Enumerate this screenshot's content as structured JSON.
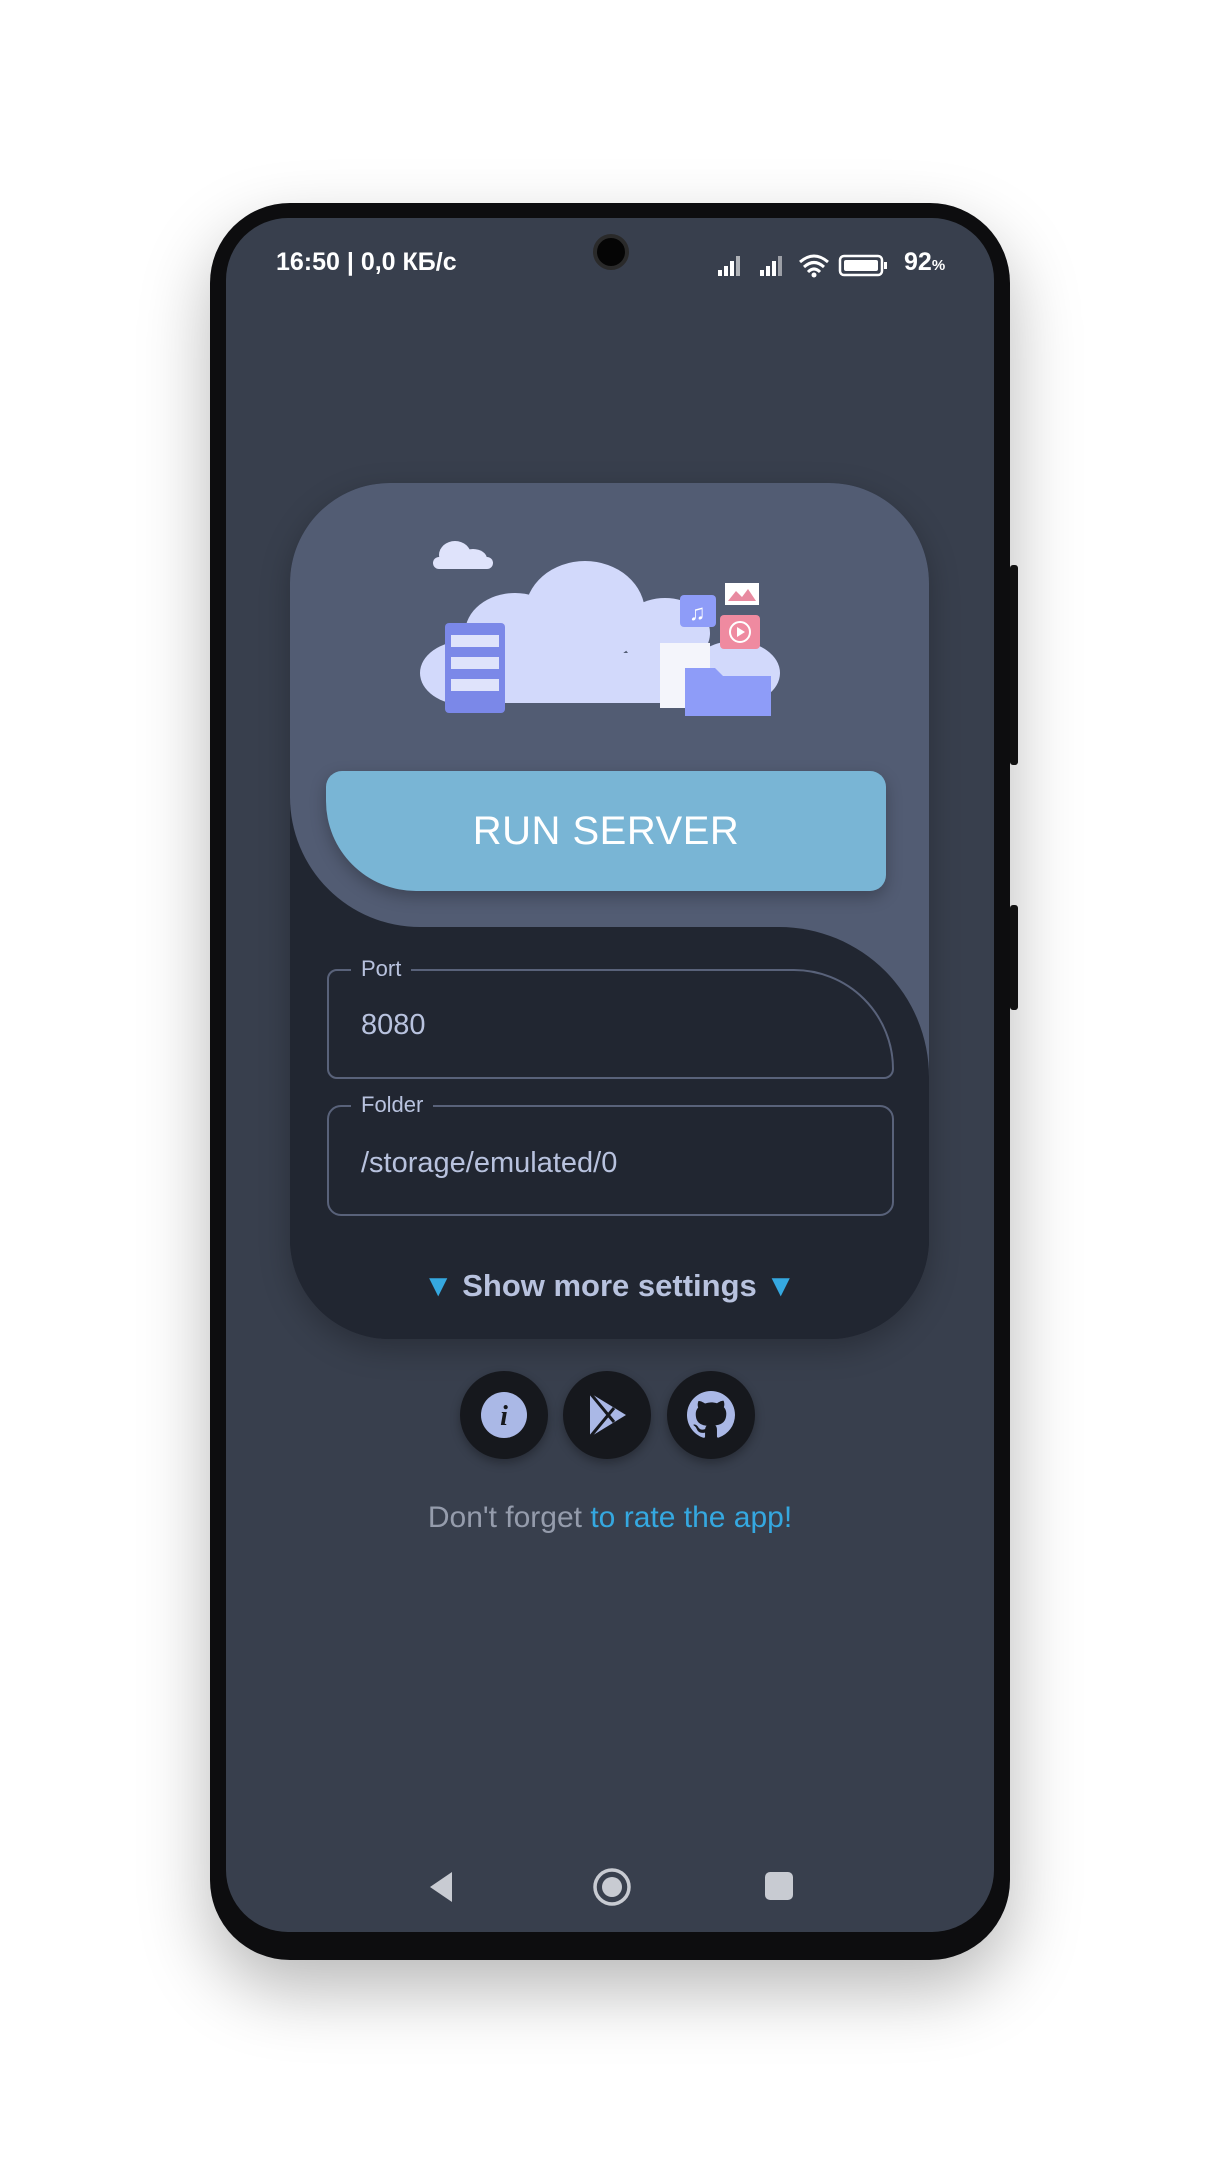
{
  "status_bar": {
    "time_speed": "16:50 | 0,0 КБ/с",
    "battery": "92",
    "battery_unit": "%"
  },
  "main": {
    "run_button": "RUN SERVER",
    "port": {
      "label": "Port",
      "value": "8080"
    },
    "folder": {
      "label": "Folder",
      "value": "/storage/emulated/0"
    },
    "show_more": "Show more settings",
    "show_more_arrow": "▼"
  },
  "links": {
    "info": "info-icon",
    "play": "google-play-icon",
    "github": "github-icon"
  },
  "footer": {
    "text": "Don't forget",
    "link": "to rate the app!"
  },
  "colors": {
    "accent": "#35a8e0",
    "button": "#79b5d5",
    "background": "#383f4d",
    "card_light": "#525c73",
    "card_dark": "#212631"
  }
}
